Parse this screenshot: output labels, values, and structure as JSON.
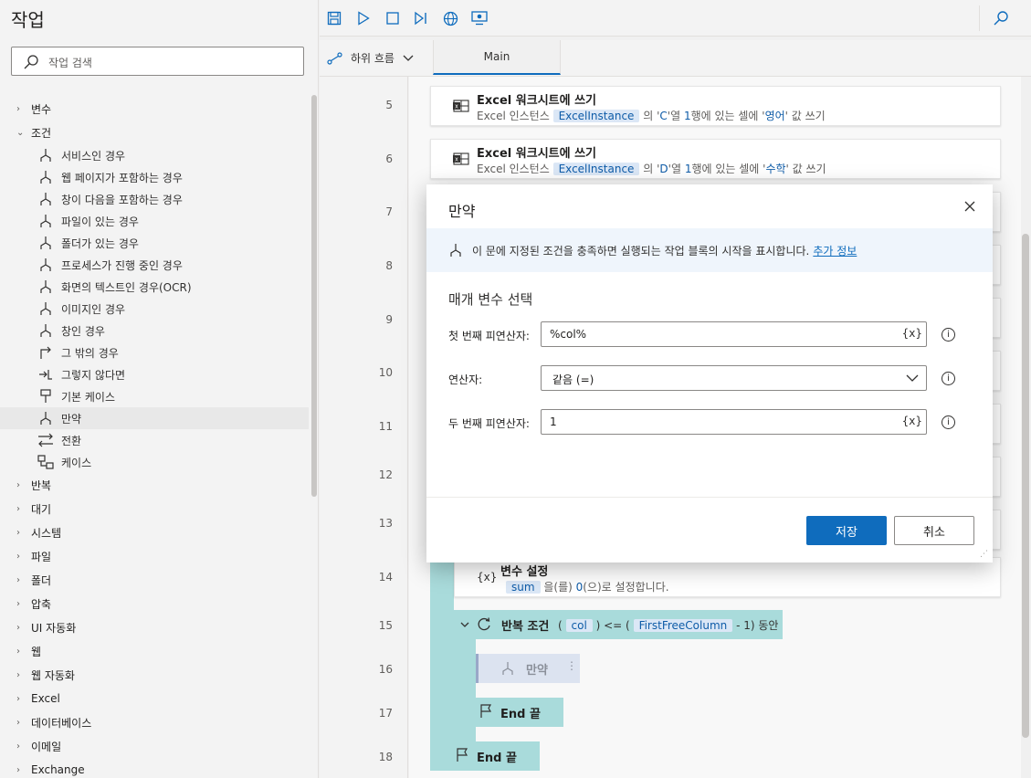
{
  "actions_pane": {
    "title": "작업",
    "search_placeholder": "작업 검색",
    "categories_top": [
      {
        "label": "변수",
        "expanded": false
      },
      {
        "label": "조건",
        "expanded": true
      }
    ],
    "condition_items": [
      {
        "label": "서비스인 경우",
        "icon": "condition-icon"
      },
      {
        "label": "웹 페이지가 포함하는 경우",
        "icon": "condition-icon"
      },
      {
        "label": "창이 다음을 포함하는 경우",
        "icon": "condition-icon"
      },
      {
        "label": "파일이 있는 경우",
        "icon": "condition-icon"
      },
      {
        "label": "폴더가 있는 경우",
        "icon": "condition-icon"
      },
      {
        "label": "프로세스가 진행 중인 경우",
        "icon": "condition-icon"
      },
      {
        "label": "화면의 텍스트인 경우(OCR)",
        "icon": "condition-icon"
      },
      {
        "label": "이미지인 경우",
        "icon": "condition-icon"
      },
      {
        "label": "창인 경우",
        "icon": "condition-icon"
      },
      {
        "label": "그 밖의 경우",
        "icon": "else-icon"
      },
      {
        "label": "그렇지 않다면",
        "icon": "else-if-icon"
      },
      {
        "label": "기본 케이스",
        "icon": "default-case-icon"
      },
      {
        "label": "만약",
        "icon": "condition-icon",
        "selected": true
      },
      {
        "label": "전환",
        "icon": "switch-icon"
      },
      {
        "label": "케이스",
        "icon": "case-icon"
      }
    ],
    "categories_bottom": [
      "반복",
      "대기",
      "시스템",
      "파일",
      "폴더",
      "압축",
      "UI 자동화",
      "웹",
      "웹 자동화",
      "Excel",
      "데이터베이스",
      "이메일",
      "Exchange"
    ]
  },
  "toolbar": {
    "icons": [
      "save-icon",
      "run-icon",
      "stop-icon",
      "run-next-icon",
      "web-recorder-icon",
      "desktop-recorder-icon",
      "search-icon"
    ]
  },
  "tabs": {
    "subflow_label": "하위 흐름",
    "main_tab": "Main"
  },
  "line_numbers": [
    "5",
    "6",
    "7",
    "8",
    "9",
    "10",
    "11",
    "12",
    "13",
    "14",
    "15",
    "16",
    "17",
    "18"
  ],
  "steps": {
    "step5": {
      "title": "Excel 워크시트에 쓰기",
      "pre": "Excel 인스턴스",
      "var": "ExcelInstance",
      "mid1": "의 '",
      "col": "C",
      "mid2": "'열 ",
      "row": "1",
      "mid3": "행에 있는 셀에 '",
      "val": "영어",
      "post": "' 값 쓰기"
    },
    "step6": {
      "title": "Excel 워크시트에 쓰기",
      "pre": "Excel 인스턴스",
      "var": "ExcelInstance",
      "mid1": "의 '",
      "col": "D",
      "mid2": "'열 ",
      "row": "1",
      "mid3": "행에 있는 셀에 '",
      "val": "수학",
      "post": "' 값 쓰기"
    },
    "step14": {
      "title": "변수 설정",
      "var": "sum",
      "mid": "을(를) ",
      "val": "0",
      "post": "(으)로 설정합니다."
    },
    "step15": {
      "title": "반복 조건",
      "open": "(",
      "var1": "col",
      "op": ") <= (",
      "var2": "FirstFreeColumn",
      "post": "- 1) 동안"
    },
    "step16": {
      "title": "만약"
    },
    "step17": {
      "title": "End 끝"
    },
    "step18": {
      "title": "End 끝"
    }
  },
  "dialog": {
    "title": "만약",
    "info_text": "이 문에 지정된 조건을 충족하면 실행되는 작업 블록의 시작을 표시합니다.",
    "info_link": "추가 정보",
    "section_title": "매개 변수 선택",
    "first_operand_label": "첫 번째 피연산자:",
    "first_operand_value": "%col%",
    "operator_label": "연산자:",
    "operator_value": "같음 (=)",
    "second_operand_label": "두 번째 피연산자:",
    "second_operand_value": "1",
    "var_button": "{x}",
    "save_label": "저장",
    "cancel_label": "취소"
  },
  "colors": {
    "accent": "#0f6cbd",
    "loop_block": "#a9dbdb",
    "chip_bg": "#dbe7f6"
  }
}
